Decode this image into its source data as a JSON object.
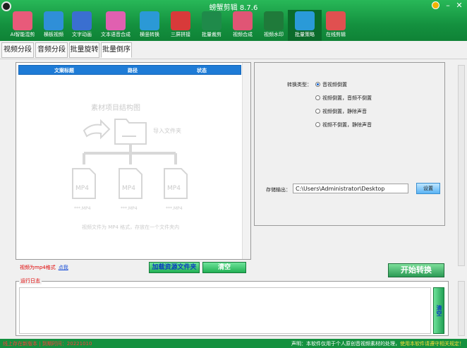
{
  "window": {
    "title": "螃蟹剪辑 8.7.6"
  },
  "toolbar": {
    "items": [
      {
        "label": "AI智能混剪",
        "icon": "ai-icon",
        "color": "#e85a7a"
      },
      {
        "label": "横板视频",
        "icon": "film-icon",
        "color": "#2f8fd8"
      },
      {
        "label": "文字动画",
        "icon": "play-icon",
        "color": "#3a6fd0"
      },
      {
        "label": "文本语音合成",
        "icon": "waveform-icon",
        "color": "#e060b0"
      },
      {
        "label": "横竖转换",
        "icon": "tv-icon",
        "color": "#2b99d6"
      },
      {
        "label": "三屏拼接",
        "icon": "split-icon",
        "color": "#d83a3a"
      },
      {
        "label": "批量裁剪",
        "icon": "crop-icon",
        "color": "#1f8a4a"
      },
      {
        "label": "视频合成",
        "icon": "grid-icon",
        "color": "#e05575"
      },
      {
        "label": "视频水印",
        "icon": "watermark-icon",
        "color": "#1f7a3a"
      },
      {
        "label": "批量策略",
        "icon": "video-camera-icon",
        "color": "#2a9ad8"
      },
      {
        "label": "在线剪辑",
        "icon": "location-icon",
        "color": "#e05050"
      }
    ],
    "active_index": 9
  },
  "tabs": [
    "视频分段",
    "音频分段",
    "批量旋转",
    "批量倒序"
  ],
  "selected_tab": 3,
  "file_table": {
    "columns": [
      "文案标题",
      "路径",
      "状态"
    ]
  },
  "diagram": {
    "title": "素材项目结构图",
    "folder_label": "导入文件夹",
    "file_icon_text": [
      "MP4",
      "MP4",
      "MP4"
    ],
    "file_captions": [
      "***.MP4",
      "***.MP4",
      "***.MP4"
    ],
    "note": "视频文件为 MP4 格式，存放在一个文件夹内"
  },
  "left_actions": {
    "hint": "视频为mp4格式",
    "hint_link": "点我",
    "add_folder": "加载资源文件夹",
    "clear": "清空"
  },
  "convert": {
    "type_label": "转换类型：",
    "options": [
      "音视频倒置",
      "视频倒置，音频不倒置",
      "视频倒置，静除声音",
      "视频不倒置，静除声音"
    ],
    "selected": 0
  },
  "output": {
    "label": "存储输出：",
    "path": "C:\\Users\\Administrator\\Desktop",
    "setting": "设置"
  },
  "start_button": "开始转换",
  "log": {
    "title": "运行日志",
    "clear": "清空"
  },
  "status": {
    "left": "线上存在新版本 | 到期时间：20221010",
    "right": "声明：本软件仅用于个人原创音视频素材的处理，",
    "right_link": "使用本软件请遵守相关规定！"
  }
}
